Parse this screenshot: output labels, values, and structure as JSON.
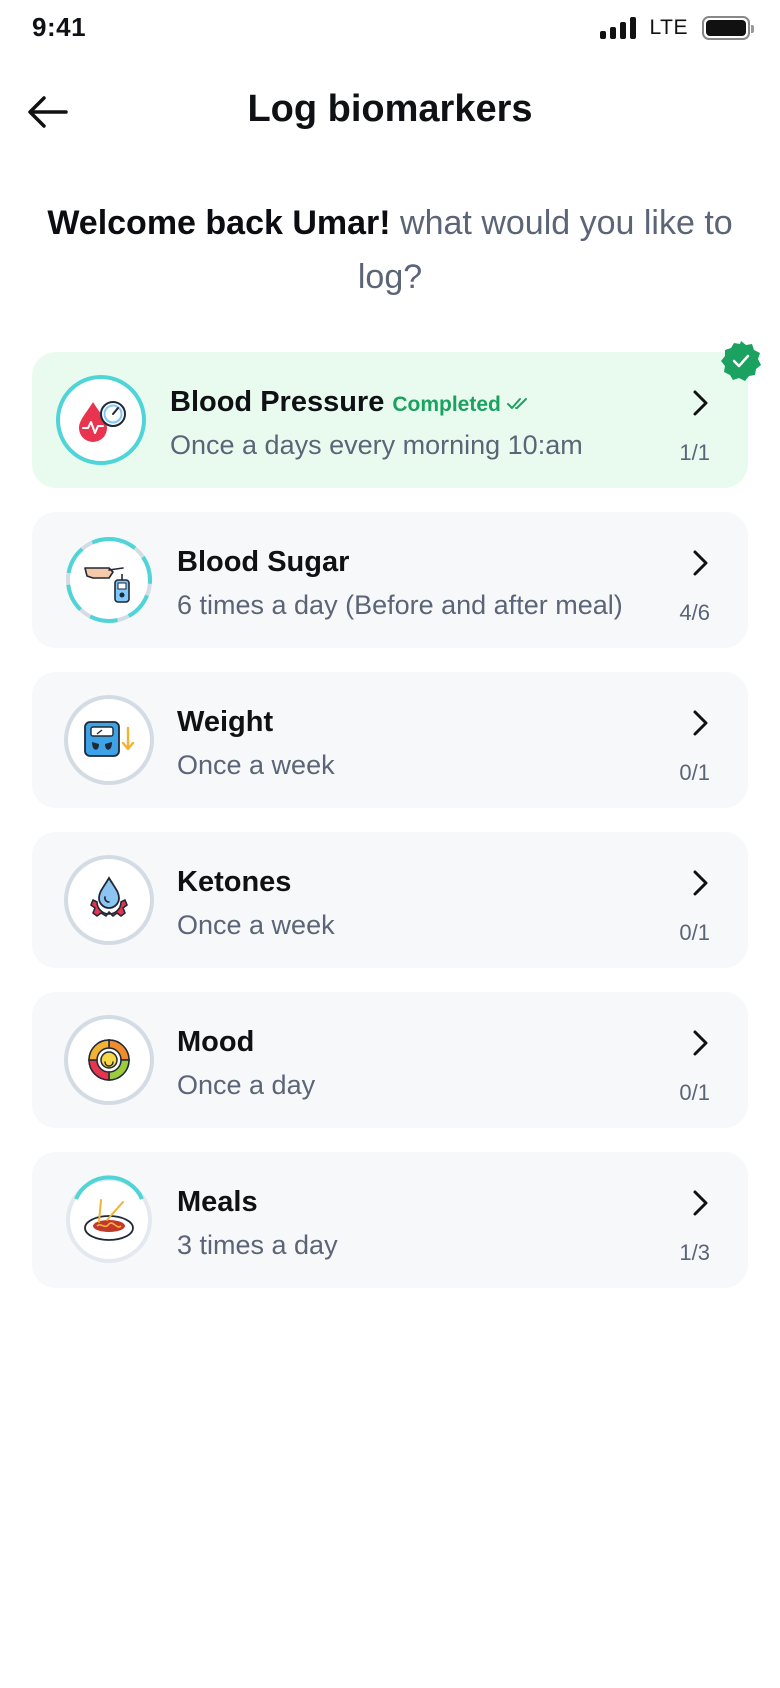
{
  "status": {
    "time": "9:41",
    "network": "LTE"
  },
  "header": {
    "title": "Log biomarkers"
  },
  "welcome": {
    "bold": "Welcome back Umar!",
    "rest": " what would you like to log?"
  },
  "items": [
    {
      "title": "Blood Pressure",
      "status": "Completed",
      "subtitle": "Once a days every morning 10:am",
      "count": "1/1",
      "icon": "blood-pressure-icon"
    },
    {
      "title": "Blood Sugar",
      "subtitle": "6 times a day (Before and after meal)",
      "count": "4/6",
      "icon": "glucometer-icon"
    },
    {
      "title": "Weight",
      "subtitle": "Once a week",
      "count": "0/1",
      "icon": "scale-icon"
    },
    {
      "title": "Ketones",
      "subtitle": "Once a week",
      "count": "0/1",
      "icon": "ketones-icon"
    },
    {
      "title": "Mood",
      "subtitle": "Once a day",
      "count": "0/1",
      "icon": "mood-icon"
    },
    {
      "title": "Meals",
      "subtitle": "3 times a day",
      "count": "1/3",
      "icon": "meal-icon"
    }
  ],
  "colors": {
    "completed": "#1ba160",
    "done_bg": "#e9fbef",
    "card_bg": "#f6f8fa",
    "accent": "#4fd4d8"
  }
}
